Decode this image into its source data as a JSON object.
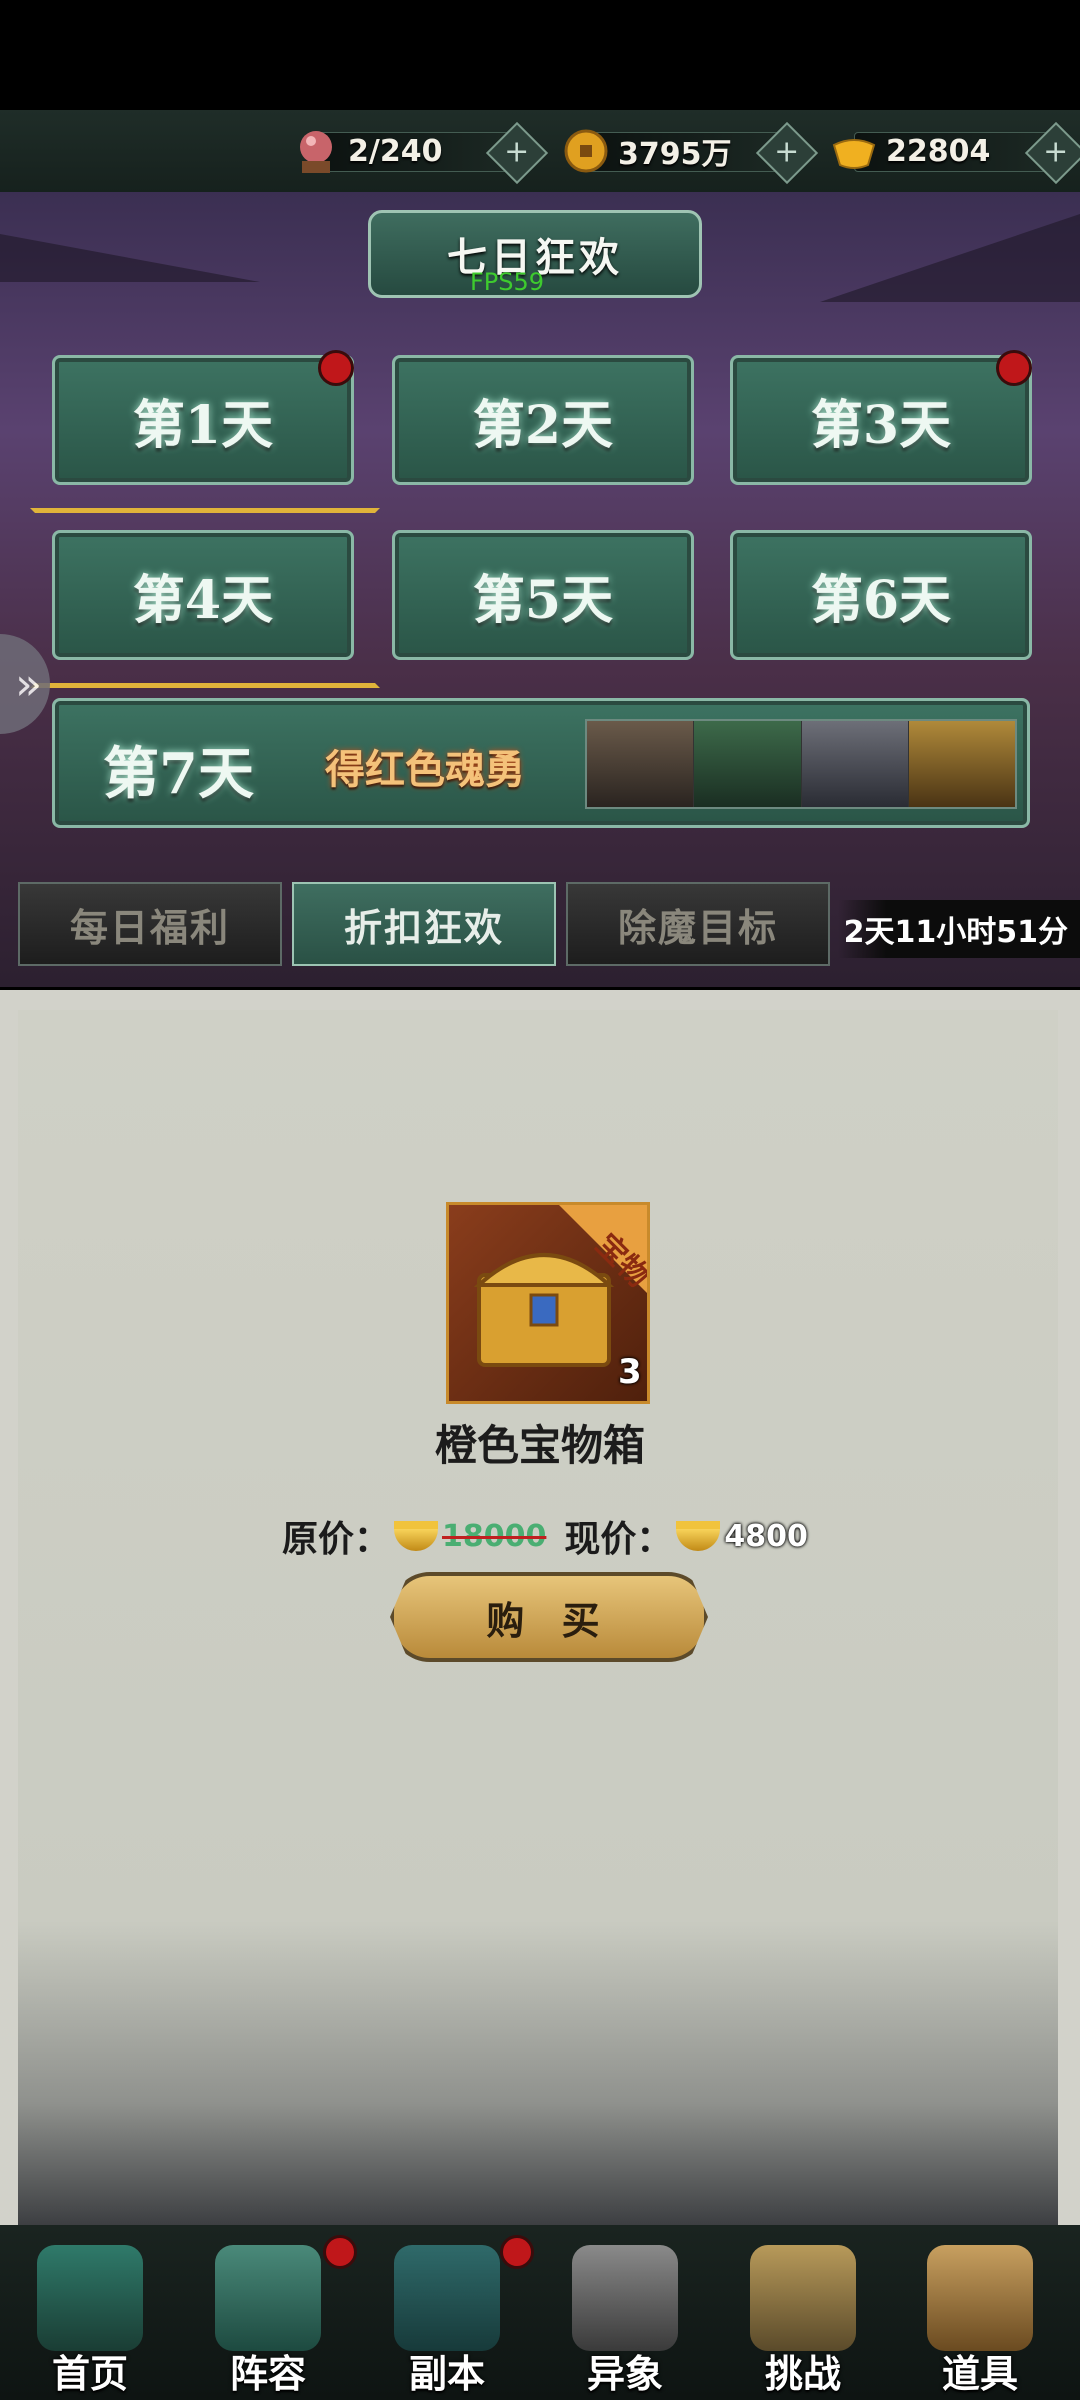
{
  "resources": [
    {
      "icon": "crystal-ball-icon",
      "value": "2/240"
    },
    {
      "icon": "coin-icon",
      "value": "3795万"
    },
    {
      "icon": "gold-ingot-icon",
      "value": "22804"
    }
  ],
  "event": {
    "title": "七日狂欢",
    "fps": "FPS59",
    "days": [
      {
        "label": "第1天",
        "badge": true
      },
      {
        "label": "第2天",
        "badge": false
      },
      {
        "label": "第3天",
        "badge": true
      },
      {
        "label": "第4天",
        "badge": false
      },
      {
        "label": "第5天",
        "badge": false
      },
      {
        "label": "第6天",
        "badge": false
      }
    ],
    "day7": {
      "label": "第7天",
      "reward": "得红色魂勇"
    },
    "tabs": [
      "每日福利",
      "折扣狂欢",
      "除魔目标"
    ],
    "active_tab": 1,
    "countdown": "2天11小时51分"
  },
  "item": {
    "icon": "treasure-chest-icon",
    "tag": "宝物",
    "count": "3",
    "name": "橙色宝物箱",
    "original_label": "原价：",
    "original_price": "18000",
    "current_label": "现价：",
    "current_price": "4800",
    "buy_label": "购 买"
  },
  "nav": [
    {
      "label": "首页",
      "icon": "palace-icon",
      "badge": false
    },
    {
      "label": "阵容",
      "icon": "book-icon",
      "badge": true
    },
    {
      "label": "副本",
      "icon": "sword-icon",
      "badge": true
    },
    {
      "label": "异象",
      "icon": "crossed-swords-icon",
      "badge": false
    },
    {
      "label": "挑战",
      "icon": "scroll-icon",
      "badge": false
    },
    {
      "label": "道具",
      "icon": "bag-icon",
      "badge": false
    }
  ]
}
